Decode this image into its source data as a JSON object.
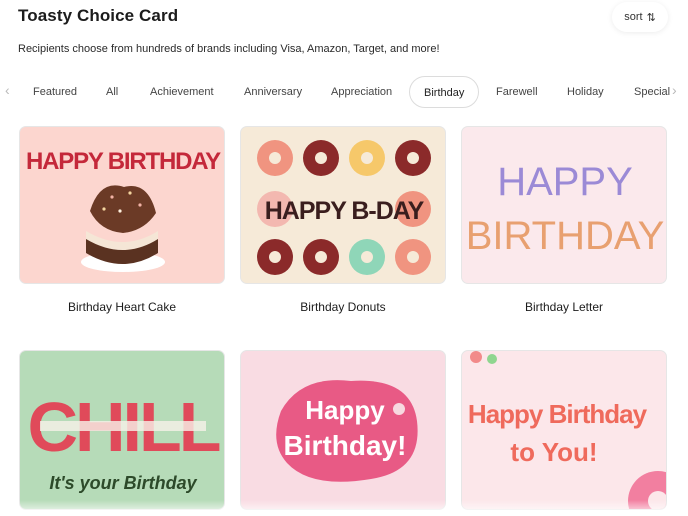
{
  "header": {
    "title": "Toasty Choice Card",
    "sort_label": "sort",
    "sort_icon": "sort-arrows-icon"
  },
  "subtitle": "Recipients choose from hundreds of brands including Visa, Amazon, Target, and more!",
  "tabs": [
    {
      "label": "Featured"
    },
    {
      "label": "All"
    },
    {
      "label": "Achievement"
    },
    {
      "label": "Anniversary"
    },
    {
      "label": "Appreciation"
    },
    {
      "label": "Birthday",
      "active": true
    },
    {
      "label": "Farewell"
    },
    {
      "label": "Holiday"
    },
    {
      "label": "Special"
    }
  ],
  "cards": [
    {
      "label": "Birthday Heart Cake",
      "art_text": "HAPPY BIRTHDAY",
      "bg": "#fcd6cf"
    },
    {
      "label": "Birthday Donuts",
      "art_text": "HAPPY B-DAY",
      "bg": "#f6ead8"
    },
    {
      "label": "Birthday Letter",
      "art_line1": "HAPPY",
      "art_line2": "BIRTHDAY",
      "bg": "#fbe9ec"
    },
    {
      "art_line1": "CHILL",
      "art_line2": "It's your Birthday",
      "bg": "#b6dbb8"
    },
    {
      "art_line1": "Happy",
      "art_line2": "Birthday!",
      "bg": "#f9dce3"
    },
    {
      "art_line1": "Happy Birthday",
      "art_line2": "to You!",
      "bg": "#fce7ea"
    }
  ],
  "colors": {
    "accent_red": "#c4283a",
    "text_dark": "#1c1c1c",
    "tab_border": "#dcdcdc"
  }
}
